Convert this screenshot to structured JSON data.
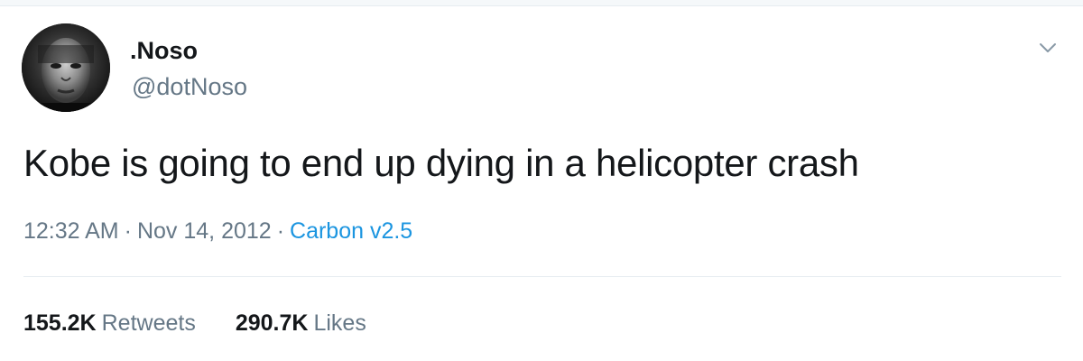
{
  "user": {
    "display_name": ".Noso",
    "handle": "@dotNoso"
  },
  "tweet": {
    "text": "Kobe is going to end up dying in a helicopter crash",
    "time": "12:32 AM",
    "date": "Nov 14, 2012",
    "separator": "·",
    "source": "Carbon v2.5"
  },
  "stats": {
    "retweets_count": "155.2K",
    "retweets_label": "Retweets",
    "likes_count": "290.7K",
    "likes_label": "Likes"
  },
  "icons": {
    "menu": "chevron-down-icon"
  },
  "colors": {
    "text": "#14171a",
    "secondary": "#657786",
    "link": "#1b95e0",
    "divider": "#e6ecf0"
  }
}
